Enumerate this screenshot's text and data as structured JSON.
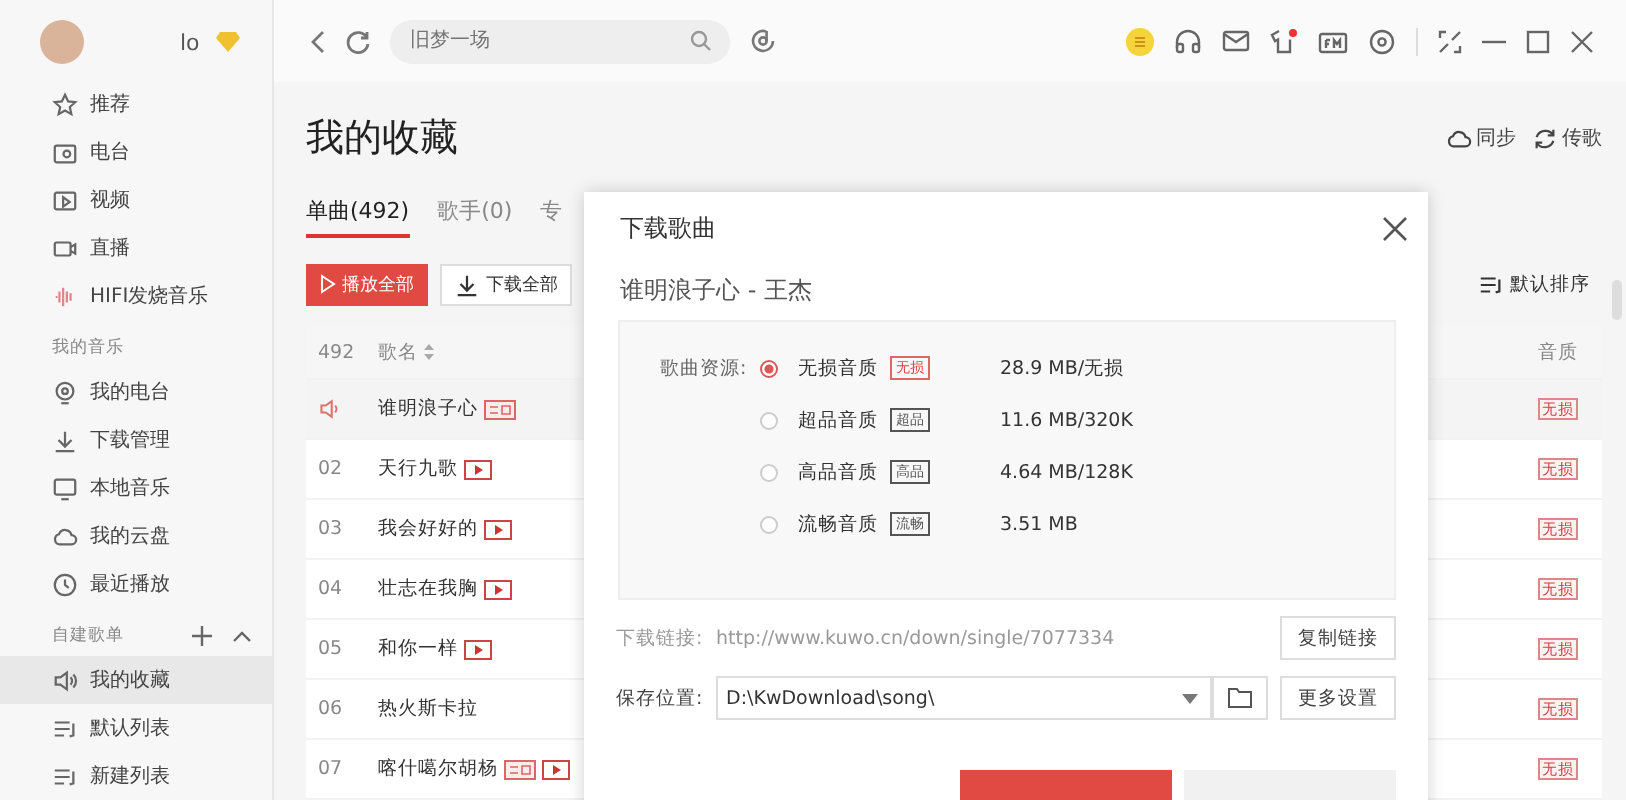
{
  "user": {
    "name": "lo"
  },
  "sidebar": {
    "items": [
      {
        "label": "推荐",
        "kind": "star",
        "selected": false
      },
      {
        "label": "电台",
        "kind": "radio",
        "selected": false
      },
      {
        "label": "视频",
        "kind": "video",
        "selected": false
      },
      {
        "label": "直播",
        "kind": "camera",
        "selected": false
      },
      {
        "label": "HIFI发烧音乐",
        "kind": "wave",
        "selected": false
      }
    ],
    "sections": [
      {
        "title": "我的音乐",
        "actions": false,
        "items": [
          {
            "label": "我的电台",
            "kind": "pin",
            "selected": false
          },
          {
            "label": "下载管理",
            "kind": "download",
            "selected": false
          },
          {
            "label": "本地音乐",
            "kind": "monitor",
            "selected": false
          },
          {
            "label": "我的云盘",
            "kind": "cloud",
            "selected": false
          },
          {
            "label": "最近播放",
            "kind": "clock",
            "selected": false
          }
        ]
      },
      {
        "title": "自建歌单",
        "actions": true,
        "items": [
          {
            "label": "我的收藏",
            "kind": "speaker",
            "selected": true
          },
          {
            "label": "默认列表",
            "kind": "list",
            "selected": false
          },
          {
            "label": "新建列表",
            "kind": "list",
            "selected": false
          }
        ]
      }
    ]
  },
  "search": {
    "placeholder": "旧梦一场"
  },
  "page": {
    "title": "我的收藏",
    "actions": [
      {
        "label": "同步",
        "kind": "cloud"
      },
      {
        "label": "传歌",
        "kind": "sync"
      }
    ],
    "tabs": [
      {
        "label": "单曲(492)",
        "selected": true
      },
      {
        "label": "歌手(0)",
        "selected": false
      },
      {
        "label": "专",
        "selected": false
      }
    ],
    "buttons": [
      {
        "label": "播放全部",
        "kind": "primary"
      },
      {
        "label": "下载全部",
        "kind": "plain"
      }
    ],
    "sort": "默认排序",
    "table": {
      "columns": [
        "492",
        "歌名",
        "音质"
      ],
      "rows": [
        {
          "index": "",
          "playing": true,
          "title": "谁明浪子心",
          "tag": true,
          "mv": false,
          "quality": "无损"
        },
        {
          "index": "02",
          "playing": false,
          "title": "天行九歌",
          "tag": false,
          "mv": true,
          "quality": "无损"
        },
        {
          "index": "03",
          "playing": false,
          "title": "我会好好的",
          "tag": false,
          "mv": true,
          "quality": "无损"
        },
        {
          "index": "04",
          "playing": false,
          "title": "壮志在我胸",
          "tag": false,
          "mv": true,
          "quality": "无损"
        },
        {
          "index": "05",
          "playing": false,
          "title": "和你一样",
          "tag": false,
          "mv": true,
          "quality": "无损"
        },
        {
          "index": "06",
          "playing": false,
          "title": "热火斯卡拉",
          "tag": false,
          "mv": false,
          "quality": "无损"
        },
        {
          "index": "07",
          "playing": false,
          "title": "喀什噶尔胡杨",
          "tag": true,
          "mv": true,
          "quality": "无损"
        }
      ]
    }
  },
  "dialog": {
    "title": "下载歌曲",
    "song": "谁明浪子心  - 王杰",
    "source_label": "歌曲资源:",
    "options": [
      {
        "label": "无损音质",
        "badge": "无损",
        "highlight": true,
        "size": "28.9  MB/无损",
        "selected": true
      },
      {
        "label": "超品音质",
        "badge": "超品",
        "highlight": false,
        "size": "11.6 MB/320K",
        "selected": false
      },
      {
        "label": "高品音质",
        "badge": "高品",
        "highlight": false,
        "size": "4.64 MB/128K",
        "selected": false
      },
      {
        "label": "流畅音质",
        "badge": "流畅",
        "highlight": false,
        "size": "3.51 MB",
        "selected": false
      }
    ],
    "link_label": "下载链接:",
    "link": "http://www.kuwo.cn/down/single/7077334",
    "copy_button": "复制链接",
    "save_label": "保存位置:",
    "save_path": "D:\\KwDownload\\song\\",
    "settings_button": "更多设置",
    "footer_buttons": [
      {
        "kind": "primary"
      },
      {
        "kind": "plain"
      }
    ]
  }
}
